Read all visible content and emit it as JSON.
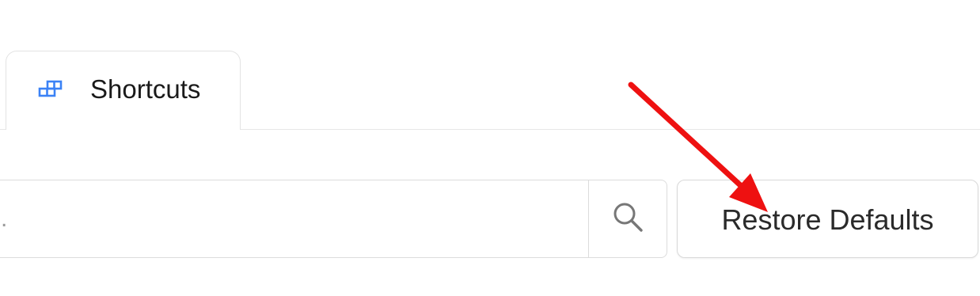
{
  "tabs": [
    {
      "label": "Shortcuts",
      "icon": "shortcuts-grid-icon",
      "selected": true
    }
  ],
  "search": {
    "placeholder": ".",
    "value": "",
    "icon": "search-icon"
  },
  "actions": {
    "restore_label": "Restore Defaults"
  },
  "annotation": {
    "type": "arrow",
    "color": "#ee1111",
    "target": "restore-defaults-button"
  },
  "colors": {
    "accent": "#3b82f6",
    "border": "#dcdcdc",
    "text": "#1a1a1a",
    "arrow": "#ee1111"
  }
}
